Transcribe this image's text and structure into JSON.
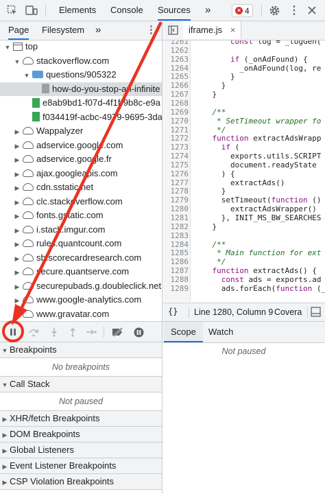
{
  "topbar": {
    "tabs": [
      "Elements",
      "Console",
      "Sources"
    ],
    "active_tab": "Sources",
    "more": "»",
    "error_count": "4"
  },
  "navigator": {
    "tabs": [
      "Page",
      "Filesystem"
    ],
    "more": "»",
    "tree": [
      {
        "label": "top",
        "indent": 0,
        "icon": "frame",
        "arrow": "▼"
      },
      {
        "label": "stackoverflow.com",
        "indent": 1,
        "icon": "cloud",
        "arrow": "▼"
      },
      {
        "label": "questions/905322",
        "indent": 2,
        "icon": "folder",
        "arrow": "▼"
      },
      {
        "label": "how-do-you-stop-an-infinite",
        "indent": 3,
        "icon": "file-gray",
        "arrow": "",
        "selected": true
      },
      {
        "label": "e8ab9bd1-f07d-4f1f-9b8c-e9a",
        "indent": 2,
        "icon": "file-green",
        "arrow": ""
      },
      {
        "label": "f034419f-acbc-4979-9695-3da",
        "indent": 2,
        "icon": "file-green",
        "arrow": ""
      },
      {
        "label": "Wappalyzer",
        "indent": 1,
        "icon": "cloud",
        "arrow": "▶"
      },
      {
        "label": "adservice.google.com",
        "indent": 1,
        "icon": "cloud",
        "arrow": "▶"
      },
      {
        "label": "adservice.google.fr",
        "indent": 1,
        "icon": "cloud",
        "arrow": "▶"
      },
      {
        "label": "ajax.googleapis.com",
        "indent": 1,
        "icon": "cloud",
        "arrow": "▶"
      },
      {
        "label": "cdn.sstatic.net",
        "indent": 1,
        "icon": "cloud",
        "arrow": "▶"
      },
      {
        "label": "clc.stackoverflow.com",
        "indent": 1,
        "icon": "cloud",
        "arrow": "▶"
      },
      {
        "label": "fonts.gstatic.com",
        "indent": 1,
        "icon": "cloud",
        "arrow": "▶"
      },
      {
        "label": "i.stack.imgur.com",
        "indent": 1,
        "icon": "cloud",
        "arrow": "▶"
      },
      {
        "label": "rules.quantcount.com",
        "indent": 1,
        "icon": "cloud",
        "arrow": "▶"
      },
      {
        "label": "sb.scorecardresearch.com",
        "indent": 1,
        "icon": "cloud",
        "arrow": "▶"
      },
      {
        "label": "secure.quantserve.com",
        "indent": 1,
        "icon": "cloud",
        "arrow": "▶"
      },
      {
        "label": "securepubads.g.doubleclick.net",
        "indent": 1,
        "icon": "cloud",
        "arrow": "▶"
      },
      {
        "label": "www.google-analytics.com",
        "indent": 1,
        "icon": "cloud",
        "arrow": "▶"
      },
      {
        "label": "www.gravatar.com",
        "indent": 1,
        "icon": "cloud",
        "arrow": "▶"
      }
    ]
  },
  "editor": {
    "file_tab": "iframe.js",
    "lines": [
      {
        "n": "1261",
        "t": "        const log = _logGen("
      },
      {
        "n": "1262",
        "t": ""
      },
      {
        "n": "1263",
        "t": "        if (_onAdFound) {"
      },
      {
        "n": "1264",
        "t": "          _onAdFound(log, re"
      },
      {
        "n": "1265",
        "t": "        }"
      },
      {
        "n": "1266",
        "t": "      }"
      },
      {
        "n": "1267",
        "t": "    }"
      },
      {
        "n": "1268",
        "t": ""
      },
      {
        "n": "1269",
        "t": "    /**",
        "c": true
      },
      {
        "n": "1270",
        "t": "     * SetTimeout wrapper fo",
        "c": true
      },
      {
        "n": "1271",
        "t": "     */",
        "c": true
      },
      {
        "n": "1272",
        "t": "    function extractAdsWrapp"
      },
      {
        "n": "1273",
        "t": "      if ("
      },
      {
        "n": "1274",
        "t": "        exports.utils.SCRIPT"
      },
      {
        "n": "1275",
        "t": "        document.readyState"
      },
      {
        "n": "1276",
        "t": "      ) {"
      },
      {
        "n": "1277",
        "t": "        extractAds()"
      },
      {
        "n": "1278",
        "t": "      }"
      },
      {
        "n": "1279",
        "t": "      setTimeout(function ()"
      },
      {
        "n": "1280",
        "t": "        extractAdsWrapper()"
      },
      {
        "n": "1281",
        "t": "      }, INIT_MS_BW_SEARCHES"
      },
      {
        "n": "1282",
        "t": "    }"
      },
      {
        "n": "1283",
        "t": ""
      },
      {
        "n": "1284",
        "t": "    /**",
        "c": true
      },
      {
        "n": "1285",
        "t": "     * Main function for ext",
        "c": true
      },
      {
        "n": "1286",
        "t": "     */",
        "c": true
      },
      {
        "n": "1287",
        "t": "    function extractAds() {"
      },
      {
        "n": "1288",
        "t": "      const ads = exports.ad"
      },
      {
        "n": "1289",
        "t": "      ads.forEach(function (_"
      }
    ],
    "status": {
      "braces": "{}",
      "position": "Line 1280, Column 9",
      "coverage": "Covera"
    }
  },
  "debugger": {
    "panes": [
      {
        "title": "Breakpoints",
        "open": true,
        "message": "No breakpoints"
      },
      {
        "title": "Call Stack",
        "open": true,
        "message": "Not paused"
      },
      {
        "title": "XHR/fetch Breakpoints",
        "open": false
      },
      {
        "title": "DOM Breakpoints",
        "open": false
      },
      {
        "title": "Global Listeners",
        "open": false
      },
      {
        "title": "Event Listener Breakpoints",
        "open": false
      },
      {
        "title": "CSP Violation Breakpoints",
        "open": false
      }
    ],
    "scope_tabs": [
      "Scope",
      "Watch"
    ],
    "active_scope_tab": "Scope",
    "scope_message": "Not paused"
  },
  "annotation": {
    "color": "#ea3323"
  }
}
